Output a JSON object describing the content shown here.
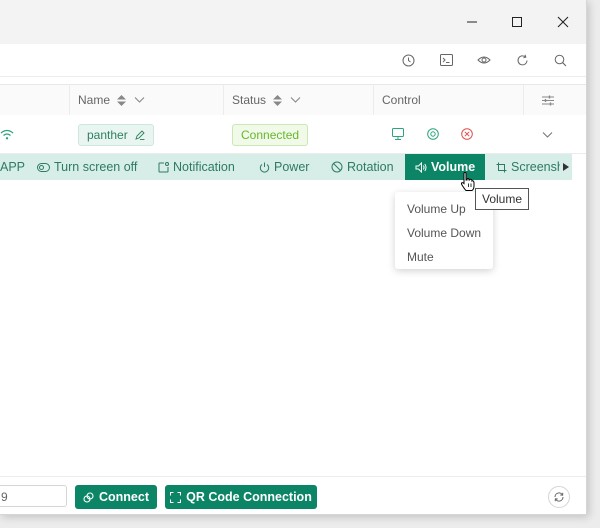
{
  "colors": {
    "accent": "#0c8566",
    "action_bar_bg": "#d7eee8",
    "status_green": "#67b82c",
    "danger": "#e05050"
  },
  "toolbar": {
    "icons": [
      "history-icon",
      "terminal-icon",
      "eye-icon",
      "refresh-icon",
      "search-icon"
    ]
  },
  "table": {
    "columns": [
      {
        "label": "Name"
      },
      {
        "label": "Status"
      },
      {
        "label": "Control"
      }
    ],
    "row": {
      "name": "panther",
      "status": "Connected"
    }
  },
  "actions": [
    {
      "label": "APP",
      "icon": "app-icon"
    },
    {
      "label": "Turn screen off",
      "icon": "eye-off-icon"
    },
    {
      "label": "Notification",
      "icon": "notification-icon"
    },
    {
      "label": "Power",
      "icon": "power-icon"
    },
    {
      "label": "Rotation",
      "icon": "rotation-icon"
    },
    {
      "label": "Volume",
      "icon": "volume-icon",
      "active": true
    },
    {
      "label": "Screensh",
      "icon": "screenshot-icon"
    }
  ],
  "volume_menu": {
    "items": [
      "Volume Up",
      "Volume Down",
      "Mute"
    ]
  },
  "tooltip": {
    "text": "Volume"
  },
  "footer": {
    "ip_value": "9",
    "connect_label": "Connect",
    "qr_label": "QR Code Connection"
  }
}
